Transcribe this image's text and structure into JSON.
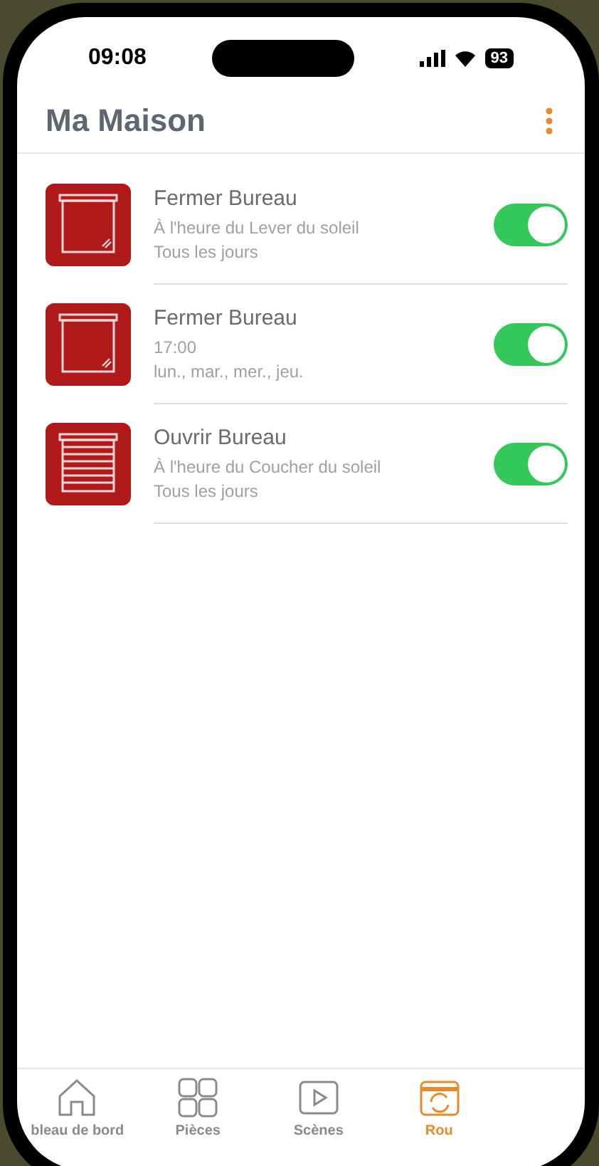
{
  "status_bar": {
    "time": "09:08",
    "battery": "93"
  },
  "header": {
    "title": "Ma Maison"
  },
  "routines": [
    {
      "kind": "closed",
      "title": "Fermer Bureau",
      "when": "À l'heure du Lever du soleil",
      "days": "Tous les jours",
      "on": true
    },
    {
      "kind": "closed",
      "title": "Fermer Bureau",
      "when": "17:00",
      "days": "lun., mar., mer., jeu.",
      "on": true
    },
    {
      "kind": "open",
      "title": "Ouvrir Bureau",
      "when": "À l'heure du Coucher du soleil",
      "days": "Tous les jours",
      "on": true
    }
  ],
  "tab_bar": [
    {
      "kind": "home",
      "label": "bleau de bord",
      "selected": false
    },
    {
      "kind": "rooms",
      "label": "Pièces",
      "selected": false
    },
    {
      "kind": "scenes",
      "label": "Scènes",
      "selected": false
    },
    {
      "kind": "routines",
      "label": "Rou",
      "selected": true
    }
  ]
}
